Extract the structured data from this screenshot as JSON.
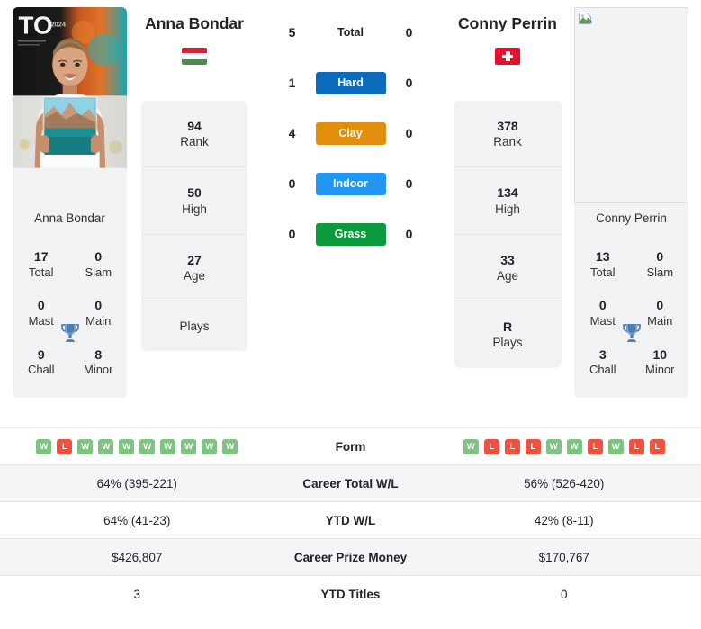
{
  "players": {
    "left": {
      "name": "Anna Bondar",
      "name_under_photo": "Anna Bondar",
      "flag": "hungary-flag",
      "photo": "player-photo",
      "titles": [
        {
          "num": "17",
          "label": "Total"
        },
        {
          "num": "0",
          "label": "Slam"
        },
        {
          "num": "0",
          "label": "Mast"
        },
        {
          "num": "0",
          "label": "Main"
        },
        {
          "num": "9",
          "label": "Chall"
        },
        {
          "num": "8",
          "label": "Minor"
        }
      ],
      "stats": [
        {
          "num": "94",
          "label": "Rank"
        },
        {
          "num": "50",
          "label": "High"
        },
        {
          "num": "27",
          "label": "Age"
        },
        {
          "num": "",
          "label": "Plays"
        }
      ],
      "surfaces": {
        "total": "5",
        "hard": "1",
        "clay": "4",
        "indoor": "0",
        "grass": "0"
      },
      "form": [
        "W",
        "L",
        "W",
        "W",
        "W",
        "W",
        "W",
        "W",
        "W",
        "W"
      ],
      "career_total_wl": "64% (395-221)",
      "ytd_wl": "64% (41-23)",
      "career_prize_money": "$426,807",
      "ytd_titles": "3"
    },
    "right": {
      "name": "Conny Perrin",
      "name_under_photo": "Conny Perrin",
      "flag": "switzerland-flag",
      "photo": "broken-image-placeholder",
      "titles": [
        {
          "num": "13",
          "label": "Total"
        },
        {
          "num": "0",
          "label": "Slam"
        },
        {
          "num": "0",
          "label": "Mast"
        },
        {
          "num": "0",
          "label": "Main"
        },
        {
          "num": "3",
          "label": "Chall"
        },
        {
          "num": "10",
          "label": "Minor"
        }
      ],
      "stats": [
        {
          "num": "378",
          "label": "Rank"
        },
        {
          "num": "134",
          "label": "High"
        },
        {
          "num": "33",
          "label": "Age"
        },
        {
          "num": "R",
          "label": "Plays"
        }
      ],
      "surfaces": {
        "total": "0",
        "hard": "0",
        "clay": "0",
        "indoor": "0",
        "grass": "0"
      },
      "form": [
        "W",
        "L",
        "L",
        "L",
        "W",
        "W",
        "L",
        "W",
        "L",
        "L"
      ],
      "career_total_wl": "56% (526-420)",
      "ytd_wl": "42% (8-11)",
      "career_prize_money": "$170,767",
      "ytd_titles": "0"
    }
  },
  "surface_labels": {
    "total": "Total",
    "hard": "Hard",
    "clay": "Clay",
    "indoor": "Indoor",
    "grass": "Grass"
  },
  "table_labels": {
    "form": "Form",
    "career_total_wl": "Career Total W/L",
    "ytd_wl": "YTD W/L",
    "career_prize_money": "Career Prize Money",
    "ytd_titles": "YTD Titles"
  },
  "colors": {
    "hard": "#0b6bba",
    "clay": "#e08e0b",
    "indoor": "#2196f3",
    "grass": "#0b9a3c",
    "win": "#7cc47f",
    "loss": "#f0503c",
    "trophy": "#4a7ebb",
    "card_bg": "#f1f2f3",
    "row_shade": "#f4f5f6"
  }
}
